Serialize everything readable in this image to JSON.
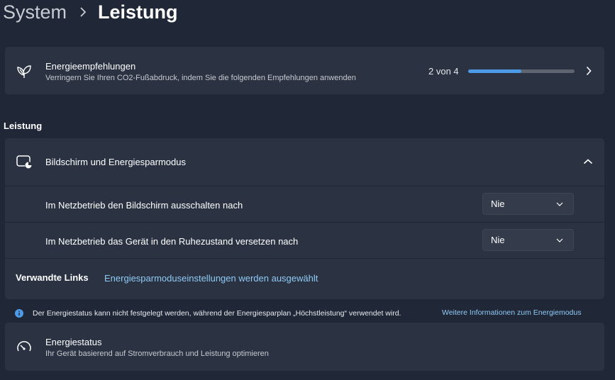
{
  "breadcrumb": {
    "parent": "System",
    "separator_icon": "chevron-right-icon",
    "current": "Leistung"
  },
  "recommendations": {
    "icon": "leaf-icon",
    "title": "Energieempfehlungen",
    "subtitle": "Verringern Sie Ihren CO2-Fußabdruck, indem Sie die folgenden Empfehlungen anwenden",
    "progress_text": "2 von 4",
    "progress_fraction": 0.5,
    "progress_color": "#4d9be6",
    "chevron_icon": "chevron-right-icon"
  },
  "section_title": "Leistung",
  "display_sleep": {
    "icon": "screen-power-icon",
    "title": "Bildschirm und Energiesparmodus",
    "chevron_icon": "chevron-up-icon",
    "rows": [
      {
        "label": "Im Netzbetrieb den Bildschirm ausschalten nach",
        "value": "Nie"
      },
      {
        "label": "Im Netzbetrieb das Gerät in den Ruhezustand versetzen nach",
        "value": "Nie"
      }
    ],
    "related_label": "Verwandte Links",
    "related_link": "Energiesparmoduseinstellungen werden ausgewählt"
  },
  "info_bar": {
    "icon": "info-icon",
    "text": "Der Energiestatus kann nicht festgelegt werden, während der Energiesparplan „Höchstleistung“ verwendet wird.",
    "link": "Weitere Informationen zum Energiemodus"
  },
  "power_mode": {
    "icon": "speedometer-icon",
    "title": "Energiestatus",
    "subtitle": "Ihr Gerät basierend auf Stromverbrauch und Leistung optimieren"
  },
  "colors": {
    "background": "#202838",
    "card": "#2b3343",
    "accent": "#4d9be6",
    "link": "#8fcaf5"
  }
}
